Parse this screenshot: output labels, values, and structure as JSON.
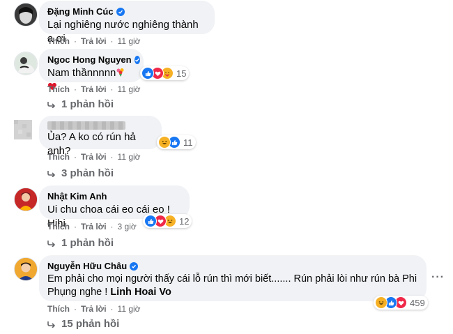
{
  "comments": [
    {
      "name": "Đặng Minh Cúc",
      "text": "Lại nghiêng nước nghiêng thành a ơi",
      "like": "Thích",
      "reply": "Trả lời",
      "time": "11 giờ"
    },
    {
      "name": "Ngoc Hong Nguyen",
      "text": "Nam thầnnnnn",
      "like": "Thích",
      "reply": "Trả lời",
      "time": "11 giờ",
      "reaction_count": "15",
      "replies": "1 phản hồi"
    },
    {
      "name": "",
      "text": "Ủa? A ko có rún hả anh?",
      "like": "Thích",
      "reply": "Trả lời",
      "time": "11 giờ",
      "reaction_count": "11",
      "replies": "3 phản hồi"
    },
    {
      "name": "Nhật Kim Anh",
      "text": "Ui chu choa cái eo cái eo ! Hihi",
      "like": "Thích",
      "reply": "Trả lời",
      "time": "3 giờ",
      "reaction_count": "12",
      "replies": "1 phản hồi"
    },
    {
      "name": "Nguyễn Hữu Châu",
      "text_line1": "Em phải cho mọi người thấy cái lỗ rún thì mới biết....... Rún phải lòi như rún bà Phi",
      "text_line2": "Phụng nghe !",
      "mention": "Linh Hoai Vo",
      "like": "Thích",
      "reply": "Trả lời",
      "time": "11 giờ",
      "reaction_count": "459",
      "replies": "15 phản hồi"
    }
  ],
  "colors": {
    "bubble": "#f0f2f5",
    "secondary_text": "#65676b",
    "like": "#1877f2",
    "love": "#f02849",
    "haha": "#f7b125"
  }
}
